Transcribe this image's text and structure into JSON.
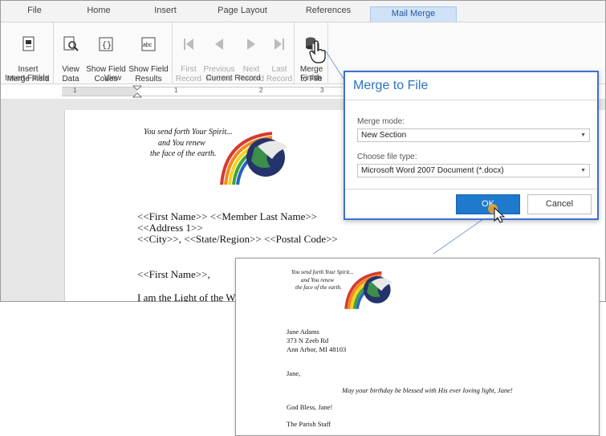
{
  "tabs": [
    "File",
    "Home",
    "Insert",
    "Page Layout",
    "References",
    "Mail Merge"
  ],
  "ribbon": {
    "insert_fields": {
      "group_label": "Insert Fields",
      "insert_merge_field": "Insert\nMerge Field"
    },
    "view": {
      "group_label": "View",
      "view_data": "View\nData",
      "show_field_codes": "Show Field\nCodes",
      "show_field_results": "Show Field\nResults"
    },
    "current_record": {
      "group_label": "Current Record",
      "first": "First\nRecord",
      "previous": "Previous\nRecord",
      "next": "Next\nRecord",
      "last": "Last\nRecord"
    },
    "finish": {
      "group_label": "Finish",
      "merge_to_file": "Merge\nto File"
    }
  },
  "ruler": {
    "numbers": [
      "1",
      "1",
      "2",
      "3"
    ]
  },
  "document": {
    "art_text_1": "You send forth Your Spirit...",
    "art_text_2": "and You renew",
    "art_text_3": "the face of the earth.",
    "address_line_1": "<<First Name>> <<Member Last Name>>",
    "address_line_2": "<<Address 1>>",
    "address_line_3": "<<City>>, <<State/Region>> <<Postal Code>>",
    "greeting": "<<First Name>>,",
    "body_start": "I am the Light of the World"
  },
  "dialog": {
    "title": "Merge to File",
    "merge_mode_label": "Merge mode:",
    "merge_mode_value": "New Section",
    "file_type_label": "Choose file type:",
    "file_type_value": "Microsoft Word 2007 Document (*.docx)",
    "ok_label": "OK",
    "cancel_label": "Cancel"
  },
  "result": {
    "name": "Jane Adams",
    "street": "373 N Zeeb Rd",
    "city_line": "Ann Arbor, MI 48103",
    "greeting": "Jane,",
    "message": "May your birthday be blessed with His ever loving light, Jane!",
    "closing": "God Bless, Jane!",
    "signature": "The Parish Staff"
  },
  "colors": {
    "accent": "#2b579a",
    "dialog_border": "#3f6fd4",
    "ok_button": "#1f79cc"
  }
}
